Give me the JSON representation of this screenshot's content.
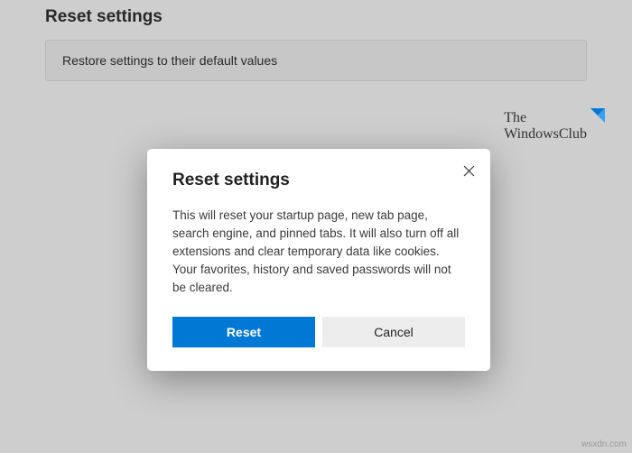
{
  "page": {
    "title": "Reset settings",
    "row_label": "Restore settings to their default values"
  },
  "watermark": {
    "line1": "The",
    "line2": "WindowsClub"
  },
  "dialog": {
    "title": "Reset settings",
    "body": "This will reset your startup page, new tab page, search engine, and pinned tabs. It will also turn off all extensions and clear temporary data like cookies. Your favorites, history and saved passwords will not be cleared.",
    "primary_label": "Reset",
    "secondary_label": "Cancel"
  },
  "source_tag": "wsxdn.com"
}
